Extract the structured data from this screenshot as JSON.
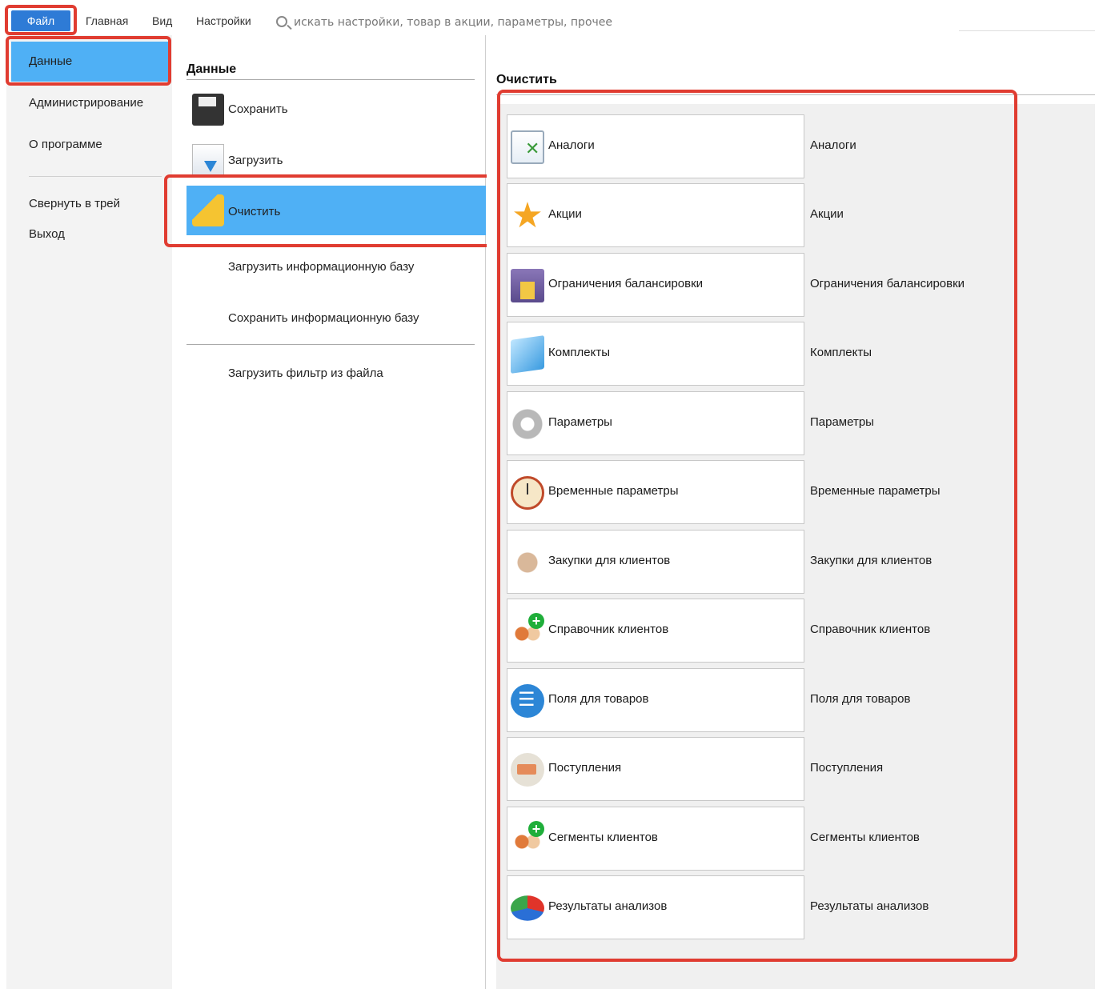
{
  "menubar": {
    "file": "Файл",
    "home": "Главная",
    "view": "Вид",
    "settings": "Настройки",
    "search_placeholder": "искать настройки, товар в акции, параметры, прочее"
  },
  "leftnav": {
    "items": [
      "Данные",
      "Администрирование",
      "О программе",
      "Свернуть в трей",
      "Выход"
    ]
  },
  "middle": {
    "title": "Данные",
    "items": [
      "Сохранить",
      "Загрузить",
      "Очистить",
      "Загрузить информационную базу",
      "Сохранить информационную базу",
      "Загрузить фильтр из файла"
    ]
  },
  "right": {
    "title": "Очистить",
    "rows": [
      {
        "label": "Аналоги",
        "desc": "Аналоги",
        "icon": "analogs-icon"
      },
      {
        "label": "Акции",
        "desc": "Акции",
        "icon": "star-icon"
      },
      {
        "label": "Ограничения балансировки",
        "desc": "Ограничения балансировки",
        "icon": "warehouse-icon"
      },
      {
        "label": "Комплекты",
        "desc": "Комплекты",
        "icon": "cube-icon"
      },
      {
        "label": "Параметры",
        "desc": "Параметры",
        "icon": "gear-icon"
      },
      {
        "label": "Временные параметры",
        "desc": "Временные параметры",
        "icon": "clock-icon"
      },
      {
        "label": "Закупки для клиентов",
        "desc": "Закупки для клиентов",
        "icon": "handshake-icon"
      },
      {
        "label": "Справочник клиентов",
        "desc": "Справочник клиентов",
        "icon": "users-add-icon"
      },
      {
        "label": "Поля для товаров",
        "desc": "Поля для товаров",
        "icon": "list-icon"
      },
      {
        "label": "Поступления",
        "desc": "Поступления",
        "icon": "truck-icon"
      },
      {
        "label": "Сегменты клиентов",
        "desc": "Сегменты клиентов",
        "icon": "users-add-icon"
      },
      {
        "label": "Результаты анализов",
        "desc": "Результаты анализов",
        "icon": "pie-chart-icon"
      }
    ]
  },
  "colors": {
    "accent": "#4fb0f5",
    "file_tab": "#2e7bd6",
    "highlight": "#e03c31"
  }
}
